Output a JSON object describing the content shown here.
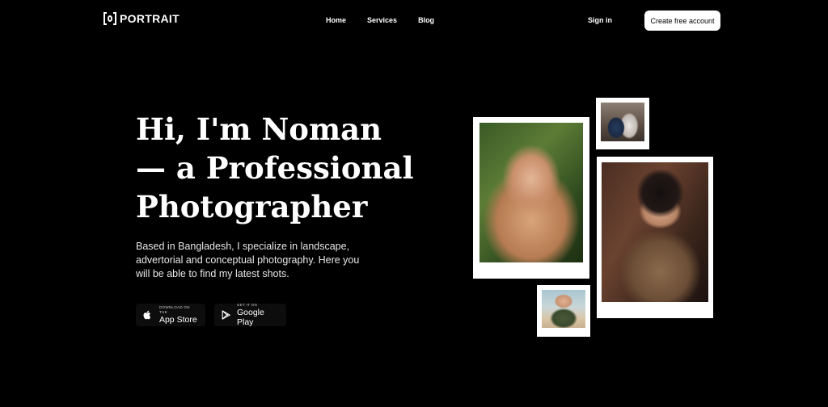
{
  "brand": {
    "name": "PORTRAIT",
    "icon": "camera-frame-icon"
  },
  "nav": {
    "links": [
      {
        "label": "Home"
      },
      {
        "label": "Services"
      },
      {
        "label": "Blog"
      }
    ],
    "signin_label": "Sign in",
    "cta_label": "Create free account"
  },
  "hero": {
    "title_line1": "Hi, I'm Noman",
    "title_line2": "— a Professional",
    "title_line3": "Photographer",
    "description": "Based in Bangladesh, I specialize in landscape, advertorial and conceptual photography. Here you will be able to find my latest shots."
  },
  "stores": {
    "apple": {
      "small": "DOWNLOAD ON THE",
      "big": "App Store",
      "icon": "apple-icon"
    },
    "google": {
      "small": "GET IT ON",
      "big": "Google Play",
      "icon": "google-play-icon"
    }
  },
  "colors": {
    "background": "#000000",
    "text": "#ffffff",
    "button_bg": "#ffffff"
  }
}
